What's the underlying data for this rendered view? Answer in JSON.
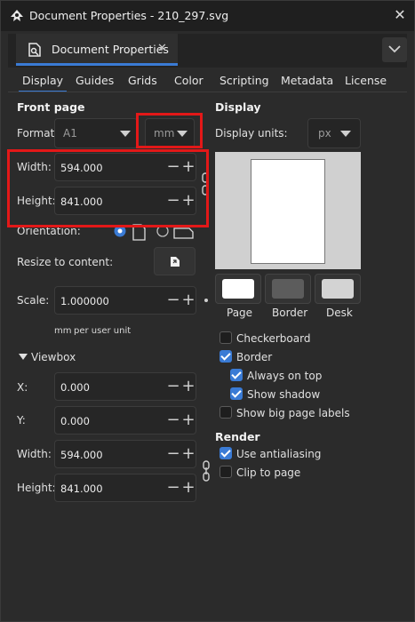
{
  "window": {
    "title": "Document Properties - 210_297.svg"
  },
  "dock_tab": {
    "label": "Document Properties"
  },
  "nav_tabs": [
    "Display",
    "Guides",
    "Grids",
    "Color",
    "Scripting",
    "Metadata",
    "License"
  ],
  "front_page": {
    "heading": "Front page",
    "format_label": "Format:",
    "format_value": "A1",
    "unit_value": "mm",
    "width_label": "Width:",
    "width_value": "594.000",
    "height_label": "Height:",
    "height_value": "841.000",
    "orientation_label": "Orientation:",
    "resize_label": "Resize to content:",
    "scale_label": "Scale:",
    "scale_value": "1.000000",
    "scale_unit": "mm",
    "scale_unit_suffix": "per user unit"
  },
  "viewbox": {
    "heading": "Viewbox",
    "x_label": "X:",
    "x_value": "0.000",
    "y_label": "Y:",
    "y_value": "0.000",
    "width_label": "Width:",
    "width_value": "594.000",
    "height_label": "Height:",
    "height_value": "841.000"
  },
  "display": {
    "heading": "Display",
    "units_label": "Display units:",
    "units_value": "px",
    "swatch_labels": [
      "Page",
      "Border",
      "Desk"
    ],
    "swatch_colors": [
      "#ffffff",
      "#5c5c5c",
      "#d3d3d3"
    ],
    "checkboxes": [
      {
        "label": "Checkerboard",
        "checked": false
      },
      {
        "label": "Border",
        "checked": true
      },
      {
        "label": "Always on top",
        "checked": true
      },
      {
        "label": "Show shadow",
        "checked": true
      },
      {
        "label": "Show big page labels",
        "checked": false
      }
    ]
  },
  "render": {
    "heading": "Render",
    "checkboxes": [
      {
        "label": "Use antialiasing",
        "checked": true
      },
      {
        "label": "Clip to page",
        "checked": false
      }
    ]
  },
  "colors": {
    "accent": "#3a7bd5",
    "highlight": "#e31818"
  }
}
